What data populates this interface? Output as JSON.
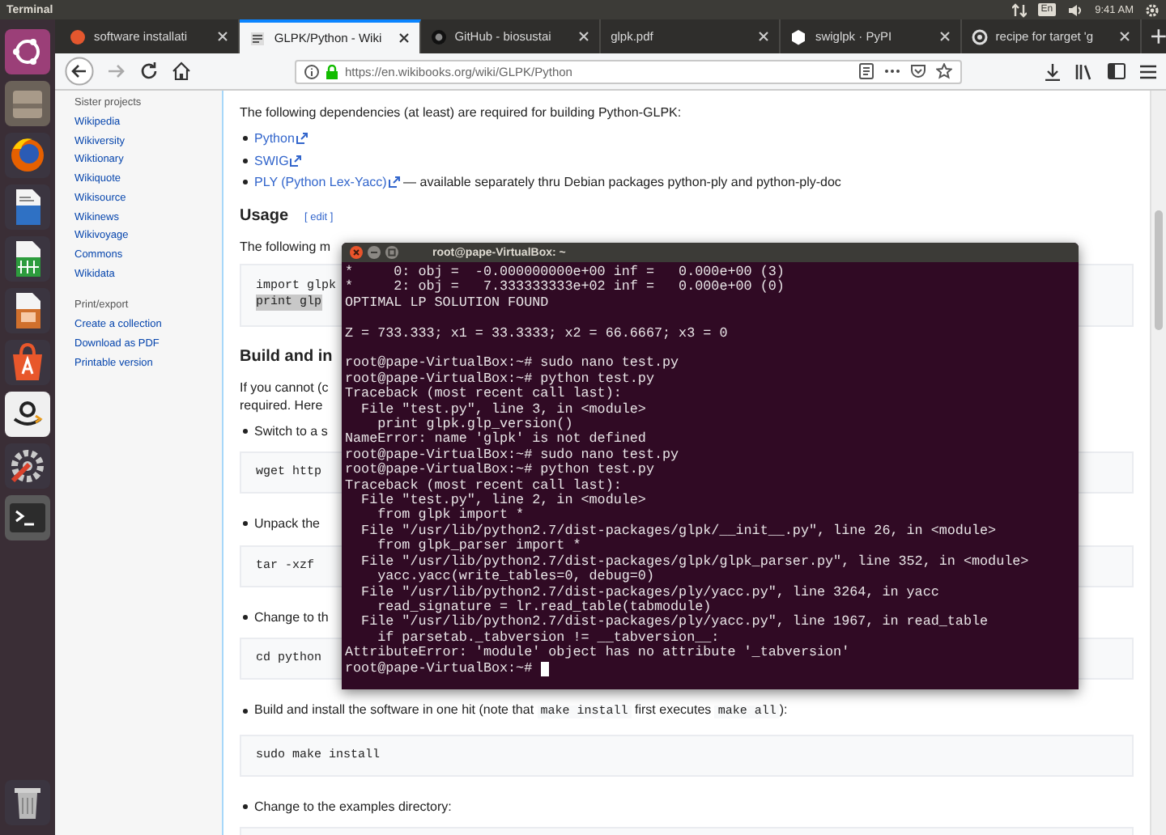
{
  "top_bar": {
    "app_title": "Terminal",
    "keyboard": "En",
    "clock": "9:41 AM"
  },
  "launcher": [
    {
      "kind": "dash"
    },
    {
      "kind": "files"
    },
    {
      "kind": "browser"
    },
    {
      "kind": "writer"
    },
    {
      "kind": "calc"
    },
    {
      "kind": "impress"
    },
    {
      "kind": "software"
    },
    {
      "kind": "shop"
    },
    {
      "kind": "settings"
    },
    {
      "kind": "terminal"
    },
    {
      "kind": "trash"
    }
  ],
  "browser": {
    "tabs": [
      {
        "label": "software installati",
        "selected": false,
        "kind": "orange"
      },
      {
        "label": "GLPK/Python - Wiki",
        "selected": true,
        "kind": "book"
      },
      {
        "label": "GitHub - biosustai",
        "selected": false,
        "kind": "dark"
      },
      {
        "label": "glpk.pdf",
        "selected": false,
        "kind": "plain"
      },
      {
        "label": "swiglpk · PyPI",
        "selected": false,
        "kind": "hexagon"
      },
      {
        "label": "recipe for target 'g",
        "selected": false,
        "kind": "ring"
      }
    ],
    "address": "https://en.wikibooks.org/wiki/GLPK/Python"
  },
  "sidebar": {
    "sections": [
      {
        "heading": "Sister projects",
        "links": [
          "Wikipedia",
          "Wikiversity",
          "Wiktionary",
          "Wikiquote",
          "Wikisource",
          "Wikinews",
          "Wikivoyage",
          "Commons",
          "Wikidata"
        ]
      },
      {
        "heading": "Print/export",
        "links": [
          "Create a collection",
          "Download as PDF",
          "Printable version"
        ]
      }
    ]
  },
  "article": {
    "blocks": [
      {
        "kind": "paragraph",
        "lines": [
          "The following dependencies (at least) are required for building Python-GLPK:"
        ]
      },
      {
        "kind": "list",
        "items": [
          {
            "parts": [
              {
                "kind": "link",
                "text": "Python"
              }
            ]
          },
          {
            "parts": [
              {
                "kind": "link",
                "text": "SWIG"
              }
            ]
          },
          {
            "parts": [
              {
                "kind": "link",
                "text": "PLY (Python Lex-Yacc)"
              },
              {
                "kind": "text",
                "text": " — available separately thru Debian packages python-ply and python-ply-doc"
              }
            ]
          }
        ]
      },
      {
        "kind": "heading",
        "text": "Usage",
        "edit": "[ edit ]"
      },
      {
        "kind": "paragraph",
        "lines": [
          "The following m"
        ]
      },
      {
        "kind": "code",
        "lines": [
          {
            "text": "import glpk",
            "highlighted": false
          },
          {
            "text": "print glp",
            "highlighted": true
          }
        ]
      },
      {
        "kind": "heading",
        "text": "Build and in"
      },
      {
        "kind": "paragraph",
        "lines": [
          "If you cannot (c",
          "required. Here"
        ]
      },
      {
        "kind": "list",
        "items": [
          {
            "parts": [
              {
                "kind": "text",
                "text": "Switch to a s"
              }
            ]
          }
        ]
      },
      {
        "kind": "code",
        "lines": [
          {
            "text": "wget http",
            "highlighted": false
          }
        ]
      },
      {
        "kind": "list",
        "items": [
          {
            "parts": [
              {
                "kind": "text",
                "text": "Unpack the"
              }
            ]
          }
        ]
      },
      {
        "kind": "code",
        "lines": [
          {
            "text": "tar -xzf",
            "highlighted": false
          }
        ]
      },
      {
        "kind": "list",
        "items": [
          {
            "parts": [
              {
                "kind": "text",
                "text": "Change to th"
              }
            ]
          }
        ]
      },
      {
        "kind": "code",
        "lines": [
          {
            "text": "cd python",
            "highlighted": false
          }
        ]
      },
      {
        "kind": "list",
        "items": [
          {
            "parts": [
              {
                "kind": "text",
                "text": "Build and install the software in one hit (note that "
              },
              {
                "kind": "code",
                "text": "make install"
              },
              {
                "kind": "text",
                "text": " first executes "
              },
              {
                "kind": "code",
                "text": "make all"
              },
              {
                "kind": "text",
                "text": "):"
              }
            ]
          }
        ]
      },
      {
        "kind": "code",
        "lines": [
          {
            "text": "sudo make install",
            "highlighted": false
          }
        ]
      },
      {
        "kind": "list",
        "items": [
          {
            "parts": [
              {
                "kind": "text",
                "text": "Change to the examples directory:"
              }
            ]
          }
        ]
      },
      {
        "kind": "code"
      }
    ]
  },
  "terminal": {
    "title": "root@pape-VirtualBox: ~",
    "cursor": true,
    "blocks": [
      [
        "*     0: obj =  -0.000000000e+00 inf =   0.000e+00 (3)",
        "*     2: obj =   7.333333333e+02 inf =   0.000e+00 (0)",
        "OPTIMAL LP SOLUTION FOUND"
      ],
      [
        "Z = 733.333; x1 = 33.3333; x2 = 66.6667; x3 = 0"
      ],
      [
        "root@pape-VirtualBox:~# sudo nano test.py",
        "root@pape-VirtualBox:~# python test.py",
        "Traceback (most recent call last):",
        "  File \"test.py\", line 3, in <module>",
        "    print glpk.glp_version()",
        "NameError: name 'glpk' is not defined",
        "root@pape-VirtualBox:~# sudo nano test.py",
        "root@pape-VirtualBox:~# python test.py",
        "Traceback (most recent call last):",
        "  File \"test.py\", line 2, in <module>",
        "    from glpk import *",
        "  File \"/usr/lib/python2.7/dist-packages/glpk/__init__.py\", line 26, in <module>",
        "    from glpk_parser import *",
        "  File \"/usr/lib/python2.7/dist-packages/glpk/glpk_parser.py\", line 352, in <module>",
        "    yacc.yacc(write_tables=0, debug=0)",
        "  File \"/usr/lib/python2.7/dist-packages/ply/yacc.py\", line 3264, in yacc",
        "    read_signature = lr.read_table(tabmodule)",
        "  File \"/usr/lib/python2.7/dist-packages/ply/yacc.py\", line 1967, in read_table",
        "    if parsetab._tabversion != __tabversion__:",
        "AttributeError: 'module' object has no attribute '_tabversion'",
        "root@pape-VirtualBox:~#"
      ]
    ]
  }
}
